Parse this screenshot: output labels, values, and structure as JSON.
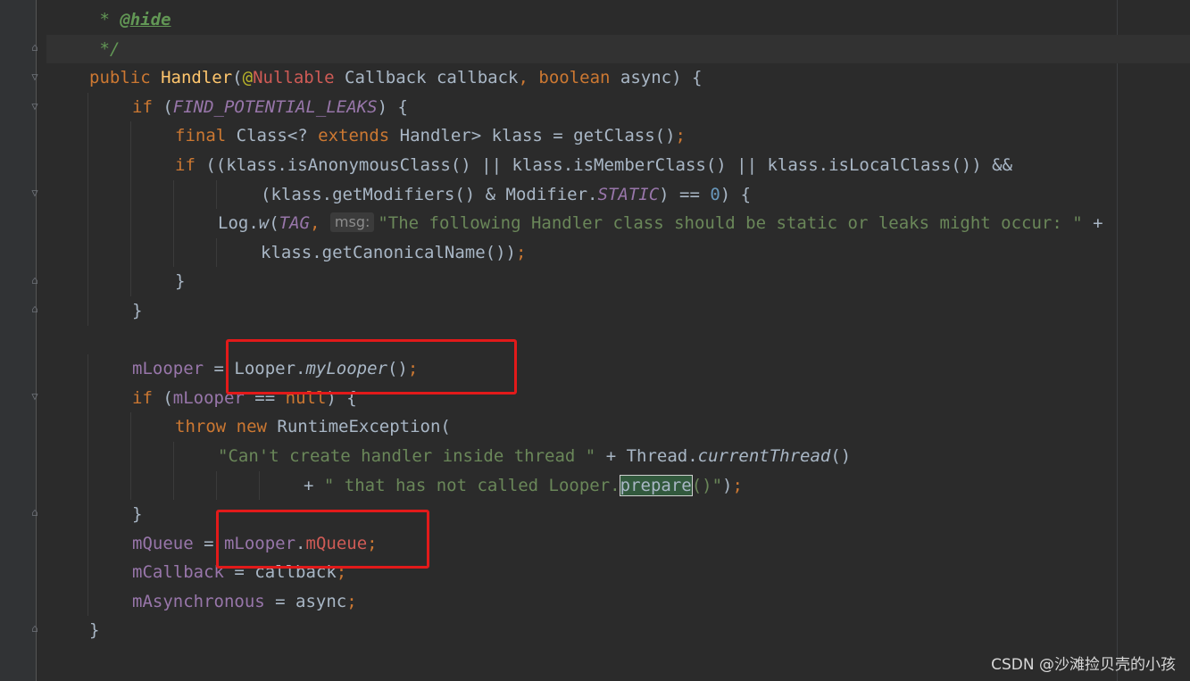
{
  "editor": {
    "lines": [
      {
        "id": "l1",
        "indent": 1,
        "tokens": [
          [
            "cmt",
            " * "
          ],
          [
            "doctag",
            "@hide"
          ]
        ]
      },
      {
        "id": "l2",
        "indent": 1,
        "tokens": [
          [
            "cmt",
            " */"
          ]
        ]
      },
      {
        "id": "l3",
        "indent": 1,
        "tokens": [
          [
            "kw",
            "public "
          ],
          [
            "fn",
            "Handler"
          ],
          [
            "",
            "("
          ],
          [
            "ann",
            "@"
          ],
          [
            "red",
            "Nullable"
          ],
          [
            "",
            " Callback callback"
          ],
          [
            "kw",
            ", "
          ],
          [
            "kw",
            "boolean "
          ],
          [
            "",
            "async) {"
          ]
        ]
      },
      {
        "id": "l4",
        "indent": 2,
        "tokens": [
          [
            "kw",
            "if "
          ],
          [
            "",
            "("
          ],
          [
            "cst",
            "FIND_POTENTIAL_LEAKS"
          ],
          [
            "",
            ") {"
          ]
        ]
      },
      {
        "id": "l5",
        "indent": 3,
        "tokens": [
          [
            "kw",
            "final "
          ],
          [
            "",
            "Class<? "
          ],
          [
            "kw",
            "extends "
          ],
          [
            "",
            "Handler> klass = getClass()"
          ],
          [
            "kw",
            ";"
          ]
        ]
      },
      {
        "id": "l6",
        "indent": 3,
        "tokens": [
          [
            "kw",
            "if "
          ],
          [
            "",
            "((klass.isAnonymousClass() || klass.isMemberClass() || klass.isLocalClass()) &&"
          ]
        ]
      },
      {
        "id": "l7",
        "indent": 5,
        "tokens": [
          [
            "",
            "(klass.getModifiers() & Modifier."
          ],
          [
            "cst",
            "STATIC"
          ],
          [
            "",
            ") == "
          ],
          [
            "num",
            "0"
          ],
          [
            "",
            ") {"
          ]
        ]
      },
      {
        "id": "l8",
        "indent": 4,
        "tokens": [
          [
            "",
            "Log."
          ],
          [
            "it",
            "w"
          ],
          [
            "",
            "("
          ],
          [
            "cst",
            "TAG"
          ],
          [
            "kw",
            ", "
          ],
          [
            "hint",
            "msg:"
          ],
          [
            "str",
            "\"The following Handler class should be static or leaks might occur: \""
          ],
          [
            "",
            " +"
          ]
        ]
      },
      {
        "id": "l9",
        "indent": 5,
        "tokens": [
          [
            "",
            "klass.getCanonicalName())"
          ],
          [
            "kw",
            ";"
          ]
        ]
      },
      {
        "id": "l10",
        "indent": 3,
        "tokens": [
          [
            "",
            "}"
          ]
        ]
      },
      {
        "id": "l11",
        "indent": 2,
        "tokens": [
          [
            "",
            "}"
          ]
        ]
      },
      {
        "id": "l12",
        "indent": 0,
        "tokens": []
      },
      {
        "id": "l13",
        "indent": 2,
        "tokens": [
          [
            "fld",
            "mLooper"
          ],
          [
            "",
            " = Looper."
          ],
          [
            "it",
            "myLooper"
          ],
          [
            "",
            "()"
          ],
          [
            "kw",
            ";"
          ]
        ]
      },
      {
        "id": "l14",
        "indent": 2,
        "tokens": [
          [
            "kw",
            "if "
          ],
          [
            "",
            "("
          ],
          [
            "fld",
            "mLooper"
          ],
          [
            "",
            " == "
          ],
          [
            "kw",
            "null"
          ],
          [
            "",
            ") {"
          ]
        ]
      },
      {
        "id": "l15",
        "indent": 3,
        "tokens": [
          [
            "kw",
            "throw new "
          ],
          [
            "",
            "RuntimeException("
          ]
        ]
      },
      {
        "id": "l16",
        "indent": 4,
        "tokens": [
          [
            "str",
            "\"Can't create handler inside thread \""
          ],
          [
            "",
            " + Thread."
          ],
          [
            "it",
            "currentThread"
          ],
          [
            "",
            "()"
          ]
        ]
      },
      {
        "id": "l17",
        "indent": 6,
        "tokens": [
          [
            "",
            "+ "
          ],
          [
            "str",
            "\" that has not called Looper."
          ],
          [
            "sel",
            "prepare"
          ],
          [
            "str",
            "()\""
          ],
          [
            "",
            ")"
          ],
          [
            "kw",
            ";"
          ]
        ]
      },
      {
        "id": "l18",
        "indent": 2,
        "tokens": [
          [
            "",
            "}"
          ]
        ]
      },
      {
        "id": "l19",
        "indent": 2,
        "tokens": [
          [
            "fld",
            "mQueue"
          ],
          [
            "",
            " = "
          ],
          [
            "fld",
            "mLooper"
          ],
          [
            "",
            "."
          ],
          [
            "red",
            "mQueue"
          ],
          [
            "kw",
            ";"
          ]
        ]
      },
      {
        "id": "l20",
        "indent": 2,
        "tokens": [
          [
            "fld",
            "mCallback"
          ],
          [
            "",
            " = callback"
          ],
          [
            "kw",
            ";"
          ]
        ]
      },
      {
        "id": "l21",
        "indent": 2,
        "tokens": [
          [
            "fld",
            "mAsynchronous"
          ],
          [
            "",
            " = async"
          ],
          [
            "kw",
            ";"
          ]
        ]
      },
      {
        "id": "l22",
        "indent": 1,
        "tokens": [
          [
            "",
            "}"
          ]
        ]
      }
    ]
  },
  "watermark": "CSDN @沙滩捡贝壳的小孩"
}
